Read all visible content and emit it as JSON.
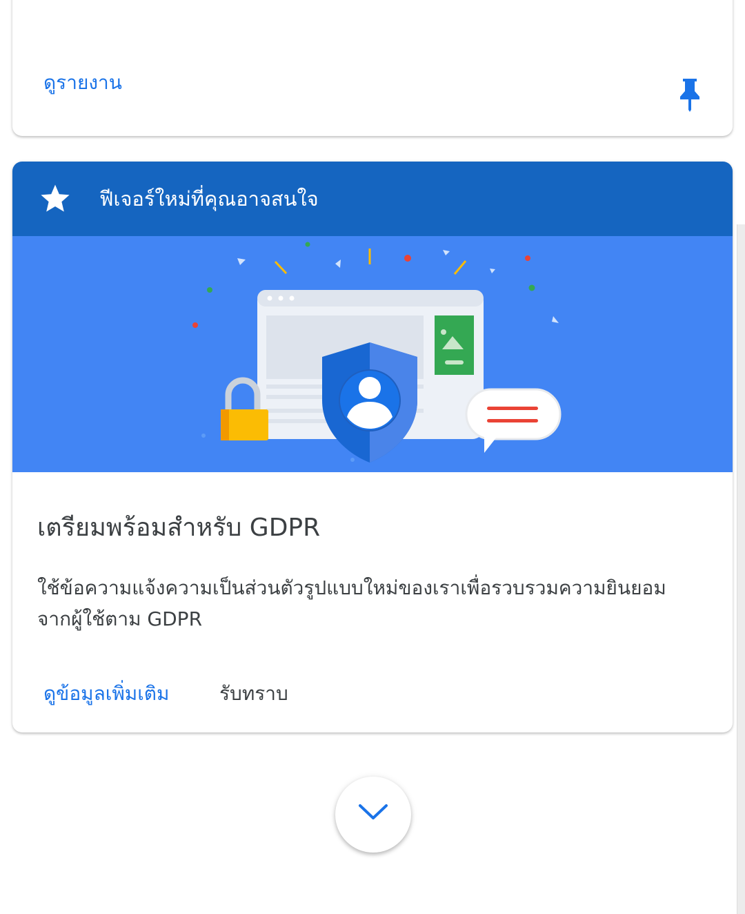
{
  "top_card": {
    "link_label": "ดูรายงาน",
    "pin_icon": "pin-icon"
  },
  "feature_card": {
    "header_title": "ฟีเจอร์ใหม่ที่คุณอาจสนใจ",
    "header_icon": "star-icon",
    "header_color": "#1565c0",
    "banner_color": "#4285f4",
    "title": "เตรียมพร้อมสำหรับ GDPR",
    "description": "ใช้ข้อความแจ้งความเป็นส่วนตัวรูปแบบใหม่ของเราเพื่อรวบรวมความยินยอมจากผู้ใช้ตาม GDPR",
    "actions": {
      "learn_more": "ดูข้อมูลเพิ่มเติม",
      "acknowledge": "รับทราบ"
    }
  },
  "scroll_button": {
    "icon": "chevron-down-icon"
  },
  "colors": {
    "accent": "#1a73e8",
    "text": "#3c4043"
  }
}
